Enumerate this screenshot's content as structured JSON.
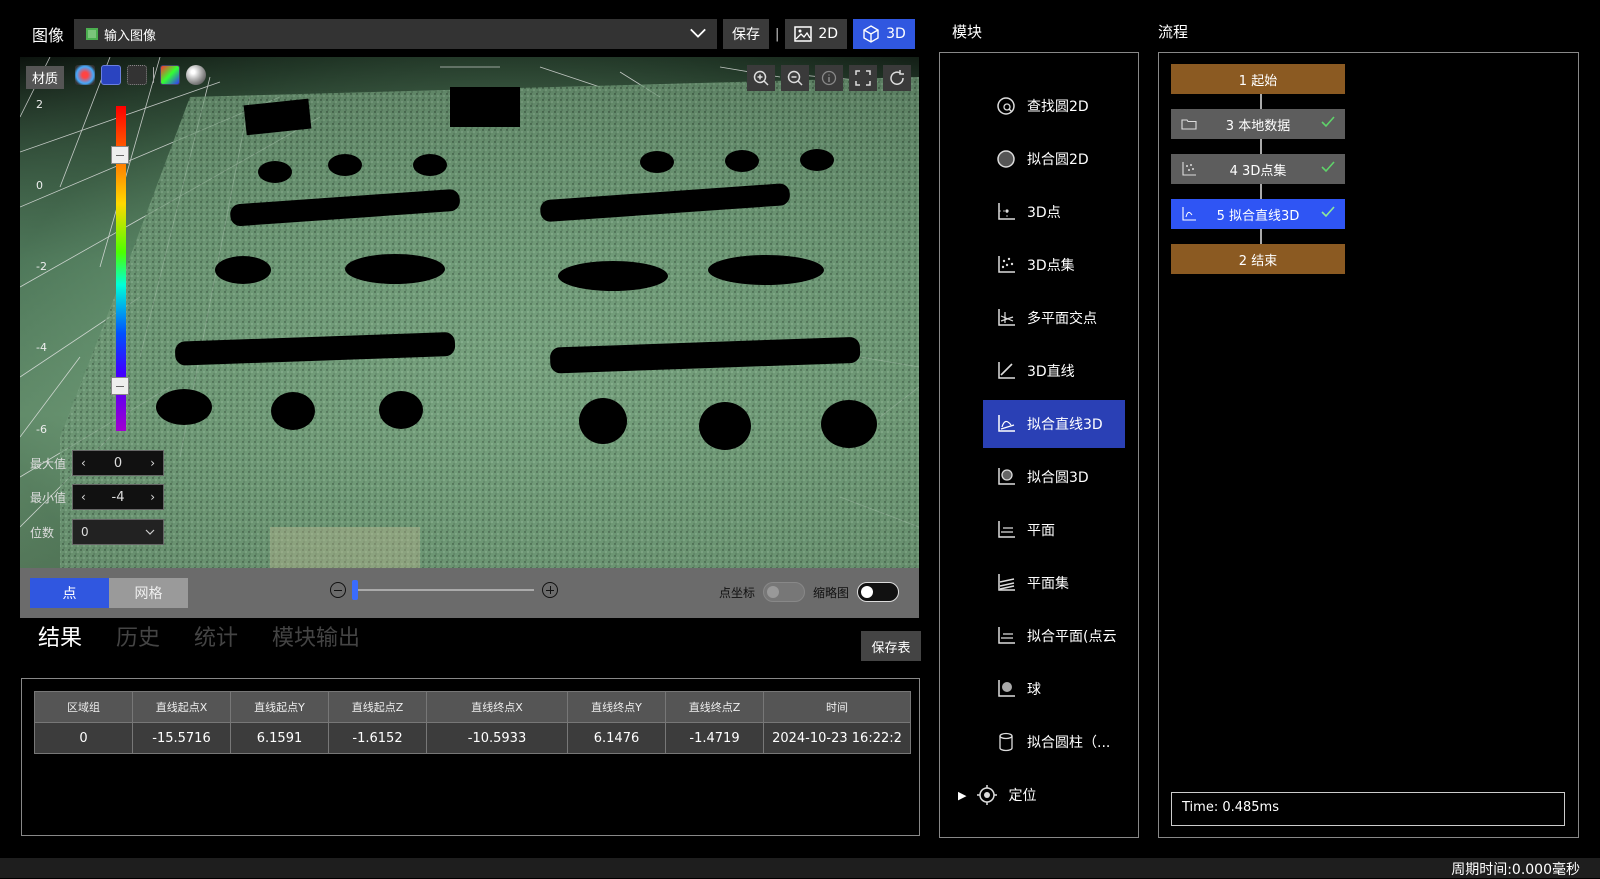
{
  "topbar": {
    "title": "图像",
    "image_select": "输入图像",
    "save_label": "保存",
    "separator": "|",
    "mode_2d": "2D",
    "mode_3d": "3D",
    "active_mode": "3D"
  },
  "viewer": {
    "material_label": "材质",
    "scale_ticks": [
      "2",
      "0",
      "-2",
      "-4",
      "-6"
    ],
    "max_label": "最大值",
    "max_value": "0",
    "min_label": "最小值",
    "min_value": "-4",
    "bits_label": "位数",
    "bits_value": "0",
    "render_modes": [
      "点",
      "网格"
    ],
    "active_render_mode": "点",
    "toggle_coords_label": "点坐标",
    "toggle_thumb_label": "缩略图",
    "toggle_coords_on": false,
    "toggle_thumb_on": false,
    "zoom_level": 0,
    "colorbar_handles": [
      0.15,
      0.86
    ],
    "colors": {
      "accent": "#3057e0",
      "cloud": "#78a27f"
    }
  },
  "results": {
    "tabs": [
      "结果",
      "历史",
      "统计",
      "模块输出"
    ],
    "active_tab": "结果",
    "save_table_label": "保存表",
    "columns": [
      "区域组",
      "直线起点X",
      "直线起点Y",
      "直线起点Z",
      "直线终点X",
      "直线终点Y",
      "直线终点Z",
      "时间"
    ],
    "rows": [
      [
        "0",
        "-15.5716",
        "6.1591",
        "-1.6152",
        "-10.5933",
        "6.1476",
        "-1.4719",
        "2024-10-23 16:22:2"
      ]
    ]
  },
  "modules": {
    "title": "模块",
    "items": [
      {
        "label": "查找圆2D",
        "icon": "find-circle-2d-icon"
      },
      {
        "label": "拟合圆2D",
        "icon": "fit-circle-2d-icon"
      },
      {
        "label": "3D点",
        "icon": "point-3d-icon"
      },
      {
        "label": "3D点集",
        "icon": "point-set-3d-icon"
      },
      {
        "label": "多平面交点",
        "icon": "multi-plane-intersection-icon"
      },
      {
        "label": "3D直线",
        "icon": "line-3d-icon"
      },
      {
        "label": "拟合直线3D",
        "icon": "fit-line-3d-icon"
      },
      {
        "label": "拟合圆3D",
        "icon": "fit-circle-3d-icon"
      },
      {
        "label": "平面",
        "icon": "plane-icon"
      },
      {
        "label": "平面集",
        "icon": "plane-set-icon"
      },
      {
        "label": "拟合平面(点云",
        "icon": "fit-plane-icon"
      },
      {
        "label": "球",
        "icon": "sphere-icon"
      },
      {
        "label": "拟合圆柱（...",
        "icon": "fit-cylinder-icon"
      }
    ],
    "selected": "拟合直线3D",
    "group_label": "定位",
    "group_arrow": "▶"
  },
  "flow": {
    "title": "流程",
    "nodes": [
      {
        "label": "1 起始",
        "style": "start",
        "checked": false
      },
      {
        "label": "3 本地数据",
        "style": "gray",
        "checked": true
      },
      {
        "label": "4 3D点集",
        "style": "gray",
        "checked": true
      },
      {
        "label": "5 拟合直线3D",
        "style": "blue",
        "checked": true
      },
      {
        "label": "2 结束",
        "style": "start",
        "checked": false
      }
    ],
    "time_text": "Time: 0.485ms"
  },
  "status": {
    "cycle_time": "周期时间:0.000毫秒"
  }
}
